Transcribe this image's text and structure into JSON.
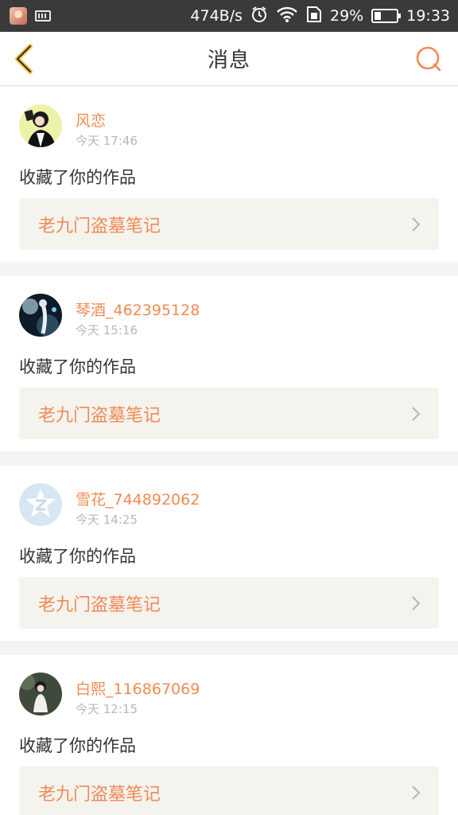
{
  "status_bar": {
    "speed": "474B/s",
    "battery_percent": "29%",
    "battery_level": 0.29,
    "time": "19:33",
    "icons": [
      "app-notification-icon",
      "keyboard-icon",
      "alarm-icon",
      "wifi-icon",
      "sim-icon",
      "battery-icon"
    ]
  },
  "nav": {
    "title": "消息",
    "back_icon": "chevron-left-icon",
    "search_icon": "search-icon",
    "accent_color": "#f08a55"
  },
  "messages": [
    {
      "username": "风恋",
      "time": "今天 17:46",
      "action": "收藏了你的作品",
      "work_title": "老九门盗墓笔记"
    },
    {
      "username": "琴酒_462395128",
      "time": "今天 15:16",
      "action": "收藏了你的作品",
      "work_title": "老九门盗墓笔记"
    },
    {
      "username": "雪花_744892062",
      "time": "今天 14:25",
      "action": "收藏了你的作品",
      "work_title": "老九门盗墓笔记"
    },
    {
      "username": "白熙_116867069",
      "time": "今天 12:15",
      "action": "收藏了你的作品",
      "work_title": "老九门盗墓笔记"
    }
  ]
}
